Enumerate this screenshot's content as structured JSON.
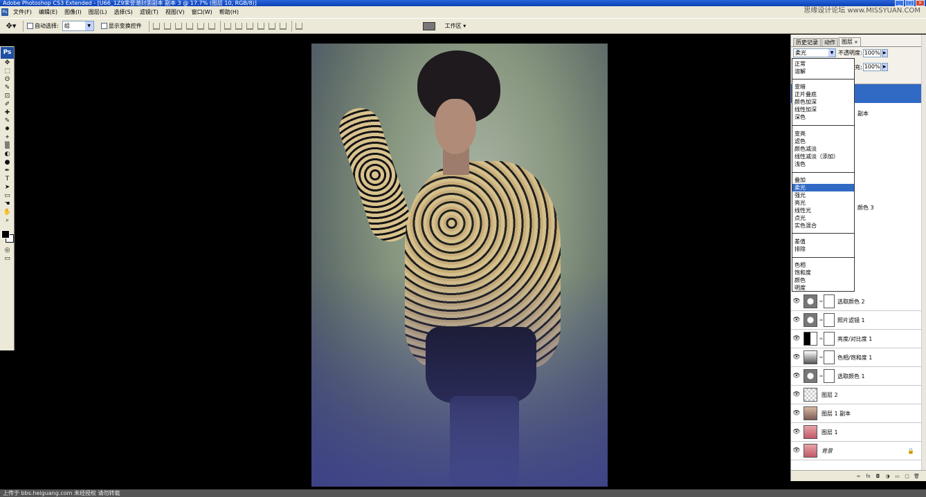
{
  "titlebar": {
    "title": "Adobe Photoshop CS3 Extended - [U66_1Z9荣誉潮封面副本 副本 3 @ 17.7% (图层 10, RGB/8)]",
    "minimize": "_",
    "maximize": "□",
    "close": "×"
  },
  "watermark": "思缘设计论坛 www.MISSYUAN.COM",
  "menubar": {
    "app_icon": "Ps",
    "items": [
      "文件(F)",
      "编辑(E)",
      "图像(I)",
      "图层(L)",
      "选择(S)",
      "滤镜(T)",
      "视图(V)",
      "窗口(W)",
      "帮助(H)"
    ]
  },
  "options": {
    "tool_icon": "move-tool-icon",
    "auto_select_label": "自动选择:",
    "auto_select_value": "组",
    "show_transform_label": "显示变换控件",
    "workspace_label": "工作区 ▾"
  },
  "tools": {
    "ps_logo": "Ps",
    "glyphs": [
      "✥",
      "⬚",
      "ʘ",
      "✎",
      "⊡",
      "✐",
      "✚",
      "✎",
      "✹",
      "⌖",
      "▒",
      "◐",
      "●",
      "✒",
      "T",
      "➤",
      "▭",
      "☚",
      "✋",
      "⌕"
    ]
  },
  "layers_panel": {
    "tabs": [
      {
        "label": "历史记录"
      },
      {
        "label": "动作"
      },
      {
        "label": "图层",
        "close": "×"
      }
    ],
    "blend_mode": "柔光",
    "opacity_label": "不透明度:",
    "opacity_value": "100%",
    "fill_label": "充:",
    "fill_value": "100%",
    "partial_names": [
      "副本",
      "颜色 3"
    ],
    "layers": [
      {
        "name": "选取颜色 2",
        "visible": "👁"
      },
      {
        "name": "照片滤镜 1",
        "visible": "👁"
      },
      {
        "name": "亮度/对比度 1",
        "visible": "👁"
      },
      {
        "name": "色相/饱和度 1",
        "visible": "👁"
      },
      {
        "name": "选取颜色 1",
        "visible": "👁"
      },
      {
        "name": "图层 2",
        "visible": "👁"
      },
      {
        "name": "图层 1 副本",
        "visible": "👁"
      },
      {
        "name": "图层 1",
        "visible": "👁"
      },
      {
        "name": "背景",
        "visible": "👁",
        "lock": "🔒"
      }
    ],
    "bottom_icons": [
      "∞",
      "fx",
      "◘",
      "◑",
      "▭",
      "▢",
      "🗑"
    ]
  },
  "blend_dropdown": {
    "groups": [
      [
        "正常",
        "溶解"
      ],
      [
        "变暗",
        "正片叠底",
        "颜色加深",
        "线性加深",
        "深色"
      ],
      [
        "变亮",
        "滤色",
        "颜色减淡",
        "线性减淡（添加）",
        "浅色"
      ],
      [
        "叠加",
        "柔光",
        "强光",
        "亮光",
        "线性光",
        "点光",
        "实色混合"
      ],
      [
        "差值",
        "排除"
      ],
      [
        "色相",
        "饱和度",
        "颜色",
        "明度"
      ]
    ],
    "selected": "柔光"
  },
  "statusbar": "上传于 bbs.heiguang.com  未经授权 请勿转载"
}
